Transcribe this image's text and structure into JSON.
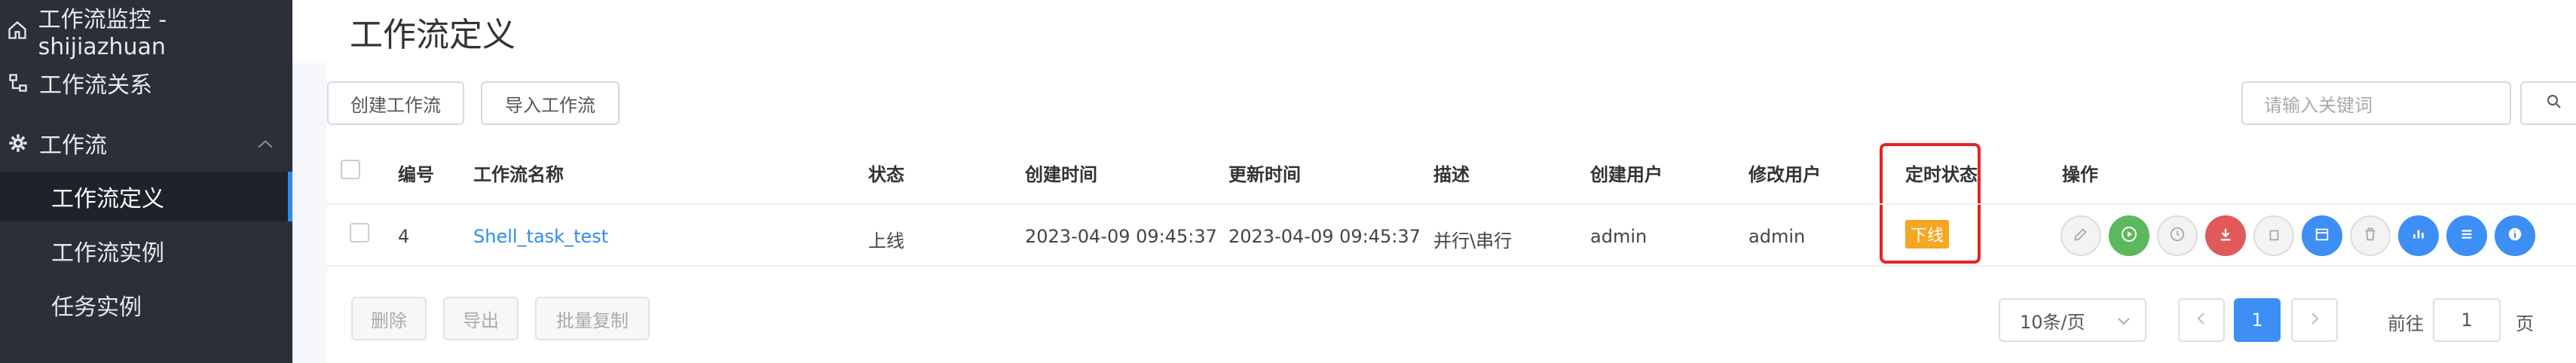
{
  "sidebar": {
    "items": [
      {
        "label": "工作流监控 - shijiazhuan",
        "icon": "home-icon"
      },
      {
        "label": "工作流关系",
        "icon": "relation-icon"
      },
      {
        "label": "工作流",
        "icon": "gear-icon"
      }
    ],
    "subitems": [
      {
        "label": "工作流定义",
        "active": true
      },
      {
        "label": "工作流实例",
        "active": false
      },
      {
        "label": "任务实例",
        "active": false
      }
    ]
  },
  "page": {
    "title": "工作流定义"
  },
  "toolbar": {
    "create_label": "创建工作流",
    "import_label": "导入工作流",
    "search_placeholder": "请输入关键词"
  },
  "table": {
    "headers": [
      "编号",
      "工作流名称",
      "状态",
      "创建时间",
      "更新时间",
      "描述",
      "创建用户",
      "修改用户",
      "定时状态",
      "操作"
    ],
    "rows": [
      {
        "id": "4",
        "name": "Shell_task_test",
        "status": "上线",
        "created": "2023-04-09 09:45:37",
        "updated": "2023-04-09 09:45:37",
        "desc": "并行\\串行",
        "creator": "admin",
        "modifier": "admin",
        "schedule_state": "下线"
      }
    ]
  },
  "bulk_actions": {
    "delete_label": "删除",
    "export_label": "导出",
    "copy_label": "批量复制"
  },
  "pagination": {
    "page_size_label": "10条/页",
    "current_page": "1",
    "goto_label": "前往",
    "goto_value": "1",
    "page_unit": "页"
  },
  "colors": {
    "accent": "#3d8ef5",
    "sidebar_bg": "#2b2f3a",
    "warning_tag": "#f5a623",
    "highlight_box": "#e02424"
  }
}
